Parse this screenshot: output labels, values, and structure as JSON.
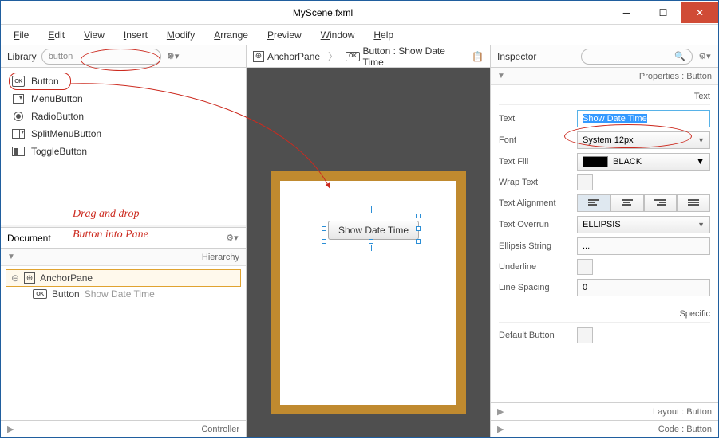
{
  "title": "MyScene.fxml",
  "menubar": [
    "File",
    "Edit",
    "View",
    "Insert",
    "Modify",
    "Arrange",
    "Preview",
    "Window",
    "Help"
  ],
  "library": {
    "title": "Library",
    "search_value": "button",
    "items": [
      {
        "label": "Button",
        "icon": "ok"
      },
      {
        "label": "MenuButton",
        "icon": "menubtn"
      },
      {
        "label": "RadioButton",
        "icon": "radio"
      },
      {
        "label": "SplitMenuButton",
        "icon": "split"
      },
      {
        "label": "ToggleButton",
        "icon": "toggle"
      }
    ]
  },
  "document": {
    "title": "Document",
    "hierarchy_label": "Hierarchy",
    "root": "AnchorPane",
    "child_type": "Button",
    "child_text": "Show Date Time",
    "controller_label": "Controller"
  },
  "breadcrumb": {
    "seg1": "AnchorPane",
    "seg2": "Button : Show Date Time"
  },
  "canvas": {
    "button_label": "Show Date Time"
  },
  "inspector": {
    "title": "Inspector",
    "properties_label": "Properties",
    "target_type": "Button",
    "section_text": "Text",
    "rows": {
      "text_label": "Text",
      "text_value": "Show Date Time",
      "font_label": "Font",
      "font_value": "System 12px",
      "fill_label": "Text Fill",
      "fill_value": "BLACK",
      "wrap_label": "Wrap Text",
      "align_label": "Text Alignment",
      "overrun_label": "Text Overrun",
      "overrun_value": "ELLIPSIS",
      "ellipsis_label": "Ellipsis String",
      "ellipsis_value": "...",
      "underline_label": "Underline",
      "spacing_label": "Line Spacing",
      "spacing_value": "0"
    },
    "section_specific": "Specific",
    "default_button_label": "Default Button",
    "layout_label": "Layout",
    "code_label": "Code"
  },
  "annotation": {
    "line1": "Drag and drop",
    "line2": "Button into Pane"
  }
}
